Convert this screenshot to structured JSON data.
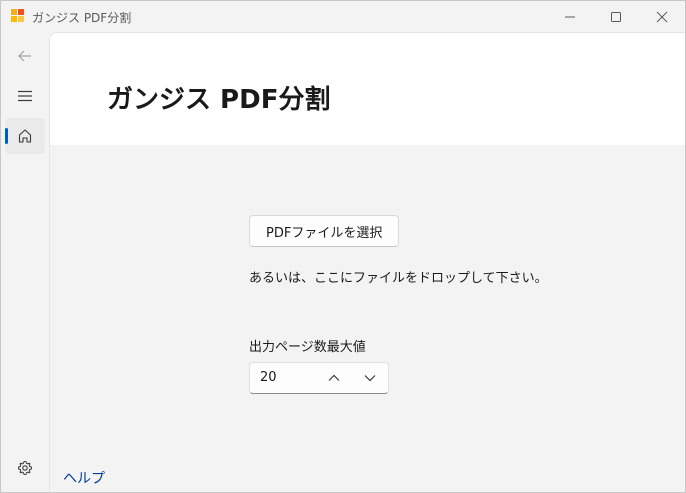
{
  "window": {
    "title": "ガンジス PDF分割"
  },
  "icons": {
    "app": "app-icon",
    "minimize": "minimize-icon",
    "maximize": "maximize-icon",
    "close": "close-icon",
    "back": "back-arrow-icon",
    "menu": "hamburger-menu-icon",
    "home": "home-icon",
    "settings": "gear-icon",
    "up": "chevron-up-icon",
    "down": "chevron-down-icon"
  },
  "colors": {
    "accent": "#005fb8",
    "link": "#003e92"
  },
  "header": {
    "title": "ガンジス PDF分割"
  },
  "main": {
    "select_button_label": "PDFファイルを選択",
    "drop_hint": "あるいは、ここにファイルをドロップして下さい。",
    "max_pages_label": "出力ページ数最大値",
    "max_pages_value": "20",
    "help_link": "ヘルプ"
  }
}
